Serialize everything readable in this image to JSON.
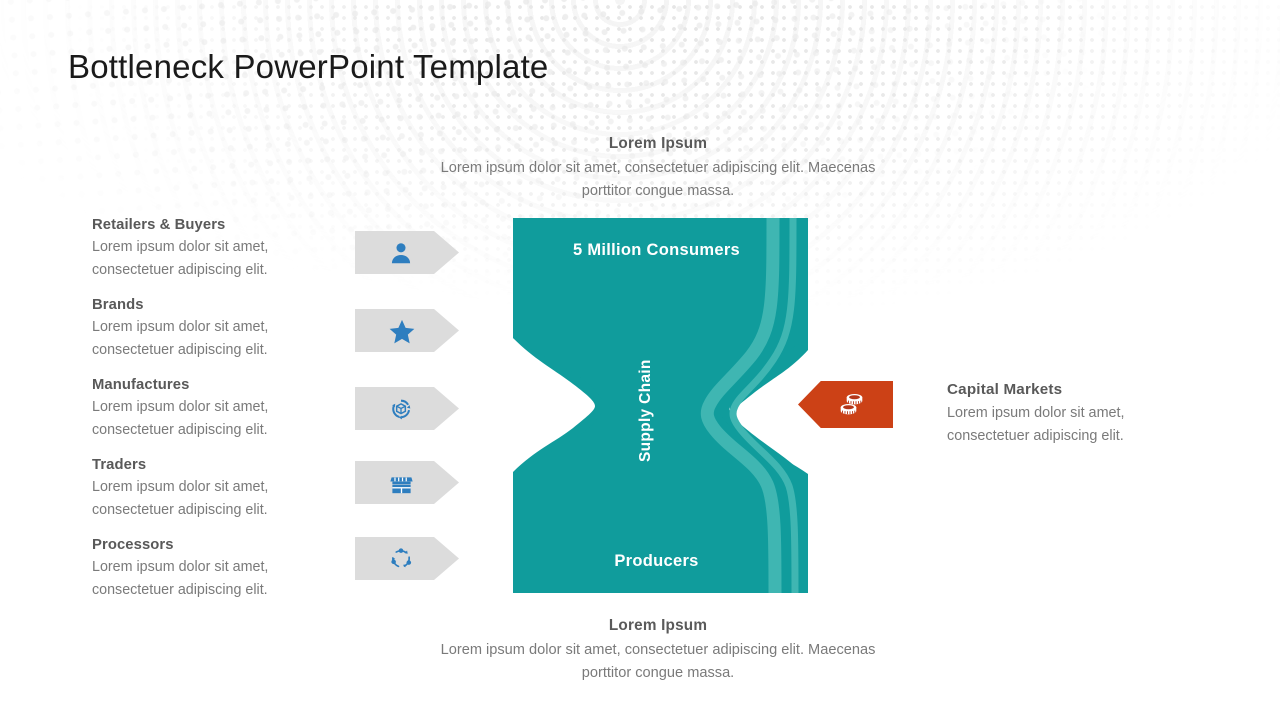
{
  "slide": {
    "title": "Bottleneck PowerPoint Template",
    "background_color": "#FFFFFF"
  },
  "colors": {
    "teal": "#109C9C",
    "teal_light": "#3FB3B0",
    "orange": "#CC4116",
    "icon_blue": "#2E7EBF",
    "chevron_gray": "#DCDCDC",
    "heading_gray": "#595959",
    "body_gray": "#7A7A7A"
  },
  "left_list": {
    "items": [
      {
        "title": "Retailers & Buyers",
        "desc": "Lorem ipsum dolor sit amet, consectetuer adipiscing elit.",
        "icon": "user-icon"
      },
      {
        "title": "Brands",
        "desc": "Lorem ipsum dolor sit amet, consectetuer adipiscing elit.",
        "icon": "star-icon"
      },
      {
        "title": "Manufactures",
        "desc": "Lorem ipsum dolor sit amet, consectetuer adipiscing elit.",
        "icon": "box-cycle-icon"
      },
      {
        "title": "Traders",
        "desc": "Lorem ipsum dolor sit amet, consectetuer adipiscing elit.",
        "icon": "storefront-icon"
      },
      {
        "title": "Processors",
        "desc": "Lorem ipsum dolor sit amet, consectetuer adipiscing elit.",
        "icon": "process-cycle-icon"
      }
    ]
  },
  "hourglass": {
    "top_label": "5 Million Consumers",
    "middle_label": "Supply Chain",
    "bottom_label": "Producers"
  },
  "top_block": {
    "title": "Lorem Ipsum",
    "desc": "Lorem ipsum dolor sit amet, consectetuer adipiscing elit. Maecenas porttitor congue massa."
  },
  "bottom_block": {
    "title": "Lorem Ipsum",
    "desc": "Lorem ipsum dolor sit amet, consectetuer adipiscing elit. Maecenas porttitor congue massa."
  },
  "right_block": {
    "title": "Capital Markets",
    "desc": "Lorem ipsum dolor sit amet, consectetuer adipiscing elit.",
    "icon": "coins-stack-icon"
  }
}
